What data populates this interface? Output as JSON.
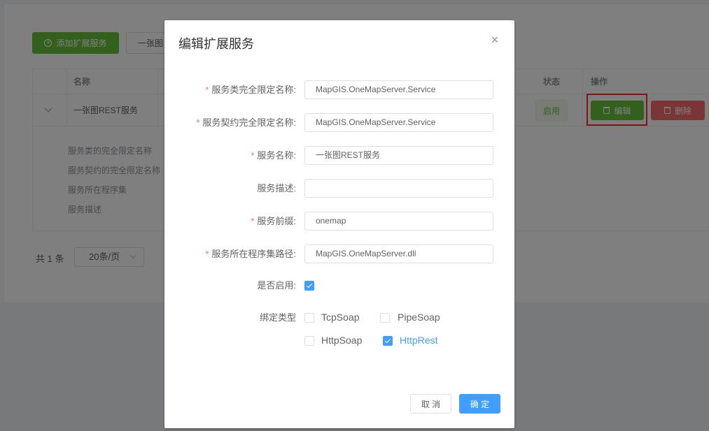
{
  "background": {
    "add_button": "添加扩展服务",
    "filter_button": "一张图",
    "table": {
      "headers": {
        "name": "名称",
        "status": "状态",
        "actions": "操作"
      },
      "row": {
        "name": "一张图REST服务",
        "status": "启用",
        "edit": "编辑",
        "delete": "删除"
      },
      "expand_labels": [
        "服务类的完全限定名称",
        "服务契约的完全限定名称",
        "服务所在程序集",
        "服务描述"
      ]
    },
    "pager": {
      "total": "共 1 条",
      "page_size": "20条/页"
    }
  },
  "dialog": {
    "title": "编辑扩展服务",
    "fields": [
      {
        "label": "服务类完全限定名称:",
        "required": true,
        "value": "MapGIS.OneMapServer.Service"
      },
      {
        "label": "服务契约完全限定名称:",
        "required": true,
        "value": "MapGIS.OneMapServer.Service"
      },
      {
        "label": "服务名称:",
        "required": true,
        "value": "一张图REST服务"
      },
      {
        "label": "服务描述:",
        "required": false,
        "value": ""
      },
      {
        "label": "服务前缀:",
        "required": true,
        "value": "onemap"
      },
      {
        "label": "服务所在程序集路径:",
        "required": true,
        "value": "MapGIS.OneMapServer.dll"
      }
    ],
    "enabled_label": "是否启用:",
    "enabled": true,
    "binding_label": "绑定类型",
    "bindings": [
      {
        "label": "TcpSoap",
        "checked": false
      },
      {
        "label": "PipeSoap",
        "checked": false
      },
      {
        "label": "HttpSoap",
        "checked": false
      },
      {
        "label": "HttpRest",
        "checked": true
      }
    ],
    "cancel": "取 消",
    "confirm": "确 定"
  },
  "colors": {
    "primary": "#409eff",
    "success": "#67c23a",
    "danger": "#f56c6c",
    "highlight": "#ff2a2a"
  }
}
